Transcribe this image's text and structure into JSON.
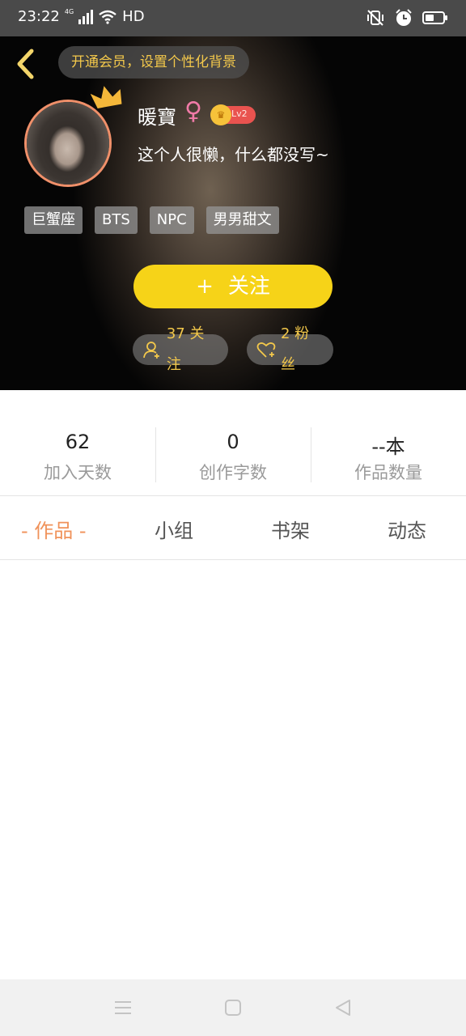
{
  "status_bar": {
    "time": "23:22",
    "network": "4G",
    "hd": "HD",
    "icons": [
      "signal-icon",
      "wifi-icon",
      "mute-vibrate-icon",
      "alarm-icon",
      "battery-icon"
    ]
  },
  "header": {
    "back_icon": "chevron-left-icon",
    "vip_prompt": "开通会员，设置个性化背景",
    "nickname": "暖寶",
    "gender_symbol": "♀",
    "level": "Lv2",
    "bio": "这个人很懒，什么都没写~",
    "tags": [
      "巨蟹座",
      "BTS",
      "NPC",
      "男男甜文"
    ],
    "follow_button": {
      "plus": "+",
      "label": "关注"
    },
    "following": "37 关注",
    "fans": "2 粉丝"
  },
  "stats": [
    {
      "value": "62",
      "label": "加入天数"
    },
    {
      "value": "0",
      "label": "创作字数"
    },
    {
      "value": "--本",
      "label": "作品数量"
    }
  ],
  "tabs": [
    "- 作品 -",
    "小组",
    "书架",
    "动态"
  ],
  "nav_bar": {
    "icons": [
      "menu-icon",
      "home-icon",
      "back-icon"
    ]
  },
  "colors": {
    "accent_yellow": "#f6d318",
    "gold_text": "#f3c84b",
    "active_tab": "#f0925a",
    "gender_pink": "#f07aa7",
    "level_red": "#e9534f"
  }
}
